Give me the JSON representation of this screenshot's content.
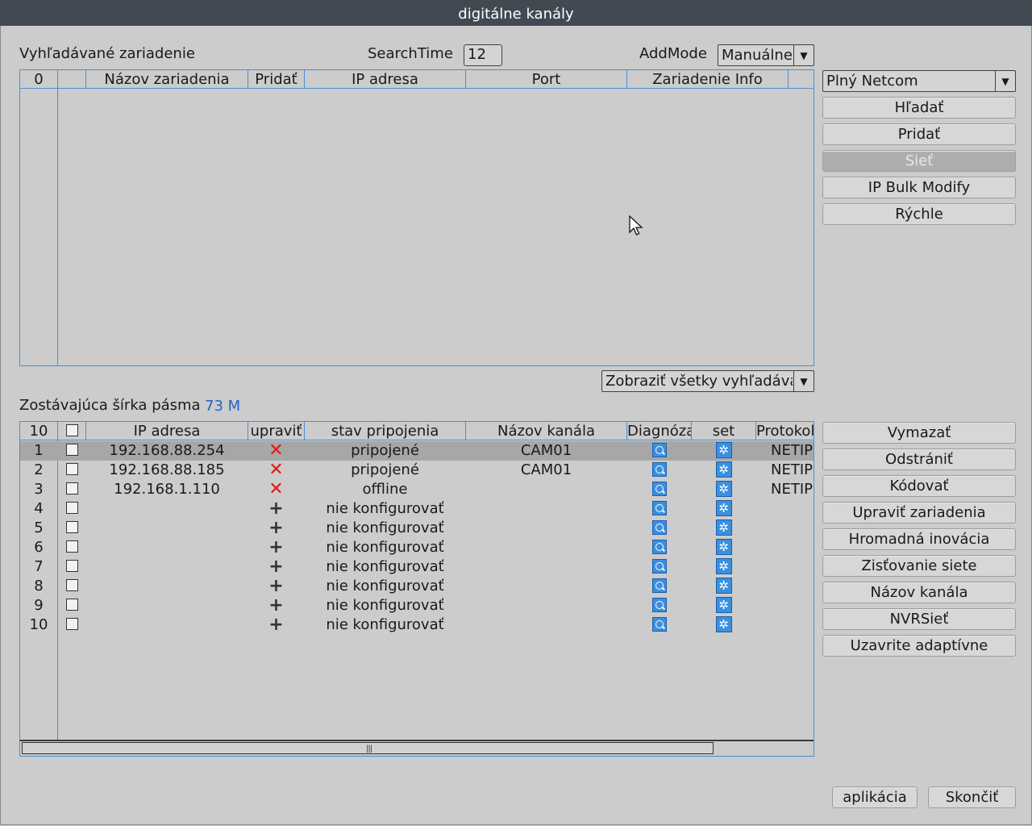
{
  "window": {
    "title": "digitálne kanály"
  },
  "search": {
    "section_label": "Vyhľadávané zariadenie",
    "search_time_label": "SearchTime",
    "search_time_value": "12",
    "add_mode_label": "AddMode",
    "add_mode_value": "Manuálne",
    "protocol_value": "Plný Netcom",
    "count": "0",
    "columns": [
      "Názov zariadenia",
      "Pridať",
      "IP adresa",
      "Port",
      "Zariadenie Info"
    ],
    "filter_value": "Zobraziť všetky vyhľadáva"
  },
  "right_buttons_top": [
    "Hľadať",
    "Pridať",
    "Sieť",
    "IP Bulk Modify",
    "Rýchle"
  ],
  "bandwidth": {
    "label": "Zostávajúca šírka pásma",
    "value": "73 M"
  },
  "channels": {
    "count": "10",
    "columns": [
      "IP adresa",
      "upraviť",
      "stav pripojenia",
      "Názov kanála",
      "Diagnóza",
      "set",
      "Protokol"
    ],
    "rows": [
      {
        "num": "1",
        "ip": "192.168.88.254",
        "action": "x",
        "status": "pripojené",
        "name": "CAM01",
        "protocol": "NETIP",
        "selected": true
      },
      {
        "num": "2",
        "ip": "192.168.88.185",
        "action": "x",
        "status": "pripojené",
        "name": "CAM01",
        "protocol": "NETIP",
        "selected": false
      },
      {
        "num": "3",
        "ip": "192.168.1.110",
        "action": "x",
        "status": "offline",
        "name": "",
        "protocol": "NETIP",
        "selected": false
      },
      {
        "num": "4",
        "ip": "",
        "action": "+",
        "status": "nie konfigurovať",
        "name": "",
        "protocol": "",
        "selected": false
      },
      {
        "num": "5",
        "ip": "",
        "action": "+",
        "status": "nie konfigurovať",
        "name": "",
        "protocol": "",
        "selected": false
      },
      {
        "num": "6",
        "ip": "",
        "action": "+",
        "status": "nie konfigurovať",
        "name": "",
        "protocol": "",
        "selected": false
      },
      {
        "num": "7",
        "ip": "",
        "action": "+",
        "status": "nie konfigurovať",
        "name": "",
        "protocol": "",
        "selected": false
      },
      {
        "num": "8",
        "ip": "",
        "action": "+",
        "status": "nie konfigurovať",
        "name": "",
        "protocol": "",
        "selected": false
      },
      {
        "num": "9",
        "ip": "",
        "action": "+",
        "status": "nie konfigurovať",
        "name": "",
        "protocol": "",
        "selected": false
      },
      {
        "num": "10",
        "ip": "",
        "action": "+",
        "status": "nie konfigurovať",
        "name": "",
        "protocol": "",
        "selected": false
      }
    ]
  },
  "right_buttons_bottom": [
    "Vymazať",
    "Odstrániť",
    "Kódovať",
    "Upraviť zariadenia",
    "Hromadná inovácia",
    "Zisťovanie siete",
    "Názov kanála",
    "NVRSieť",
    "Uzavrite adaptívne"
  ],
  "footer": {
    "apply": "aplikácia",
    "exit": "Skončiť"
  },
  "colors": {
    "accent": "#4c8fd0",
    "title_bar": "#414a52",
    "bandwidth": "#1f64c8",
    "delete_icon": "#e01818"
  }
}
